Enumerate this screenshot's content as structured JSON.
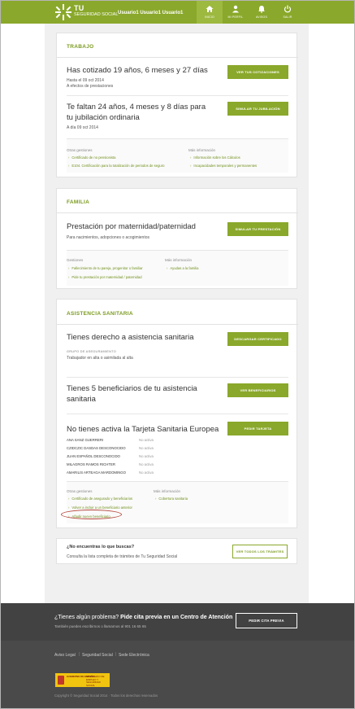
{
  "header": {
    "brand_tu": "TU",
    "brand_ss": "SEGURIDAD SOCIAL",
    "username": "Usuario1 Usuario1 Usuario1",
    "nav": [
      {
        "label": "INICIO",
        "icon": "home-icon"
      },
      {
        "label": "MI PERFIL",
        "icon": "user-icon"
      },
      {
        "label": "AVISOS",
        "icon": "bell-icon"
      },
      {
        "label": "SALIR",
        "icon": "power-icon"
      }
    ],
    "colors": {
      "accent": "#8aa82b"
    }
  },
  "trabajo": {
    "title": "TRABAJO",
    "cotizado": "Has cotizado 19 años, 6 meses y 27 días",
    "hasta": "Hasta el 09 oct 2014",
    "efectos": "A efectos de prestaciones",
    "btn_cotizaciones": "VER TUS COTIZACIONES",
    "faltan": "Te faltan 24 años, 4 meses y 8 días para tu jubilación ordinaria",
    "adia": "A día 09 oct 2014",
    "btn_jubilacion": "SIMULAR TU JUBILACIÓN",
    "gestiones_label": "Otras gestiones",
    "gestiones": [
      "Certificado de no pensionista",
      "E104. Certificación para la totalización de periodos de seguro"
    ],
    "info_label": "Más información",
    "info": [
      "Información sobre los Cálculos",
      "Incapacidades temporales y permanentes"
    ]
  },
  "familia": {
    "title": "FAMILIA",
    "prestacion": "Prestación por maternidad/paternidad",
    "desc": "Para nacimientos, adopciones o acogimientos",
    "btn": "SIMULAR TU PRESTACIÓN",
    "gestiones_label": "Gestiones",
    "gestiones": [
      "Fallecimiento de tu pareja, progenitor o familiar",
      "Pide tu prestación por maternidad / paternidad"
    ],
    "info_label": "Más información",
    "info": [
      "Ayudas a la familia"
    ]
  },
  "asistencia": {
    "title": "ASISTENCIA SANITARIA",
    "derecho": "Tienes derecho a asistencia sanitaria",
    "grupo_label": "GRUPO DE ASEGURAMIENTO",
    "grupo_value": "Trabajador en alta o asimilada al alta",
    "btn_certificado": "DESCARGAR CERTIFICADO",
    "beneficiarios": "Tienes 5 beneficiarios de tu asistencia sanitaria",
    "btn_beneficiarios": "VER BENEFICIARIOS",
    "tarjeta": "No tienes activa la Tarjeta Sanitaria Europea",
    "btn_tarjeta": "PEDIR TARJETA",
    "personas": [
      {
        "name": "ANA SANZ GUERRERI",
        "status": "No activa"
      },
      {
        "name": "CZIDCZIC DASDAS DESCONOCIDO",
        "status": "No activa"
      },
      {
        "name": "JUAN ESPAÑOL DESCONOCIDO",
        "status": "No activa"
      },
      {
        "name": "MILAGROS RAMOS RICHTER",
        "status": "No activa"
      },
      {
        "name": "AMARILIS ARTEAGA MARDOMINGO",
        "status": "No activa"
      }
    ],
    "gestiones_label": "Otras gestiones",
    "gestiones": [
      "Certificado de asegurado y beneficiarios",
      "Volver a incluir a un beneficiario anterior",
      "Añadir nuevo beneficiario"
    ],
    "info_label": "Más información",
    "info": [
      "Cobertura sanitaria"
    ]
  },
  "buscas": {
    "title": "¿No encuentras lo que buscas?",
    "desc": "Consulta la lista completa de trámites de Tu Seguridad Social",
    "btn": "VER TODOS LOS TRÁMITES"
  },
  "footer": {
    "problema": "¿Tienes algún problema?",
    "pide": "Pide cita previa en un Centro de Atención",
    "sub": "También puedes escribirnos o llamarnos al 901 16 65 65",
    "btn": "PEDIR CITA PREVIA",
    "links": [
      "Aviso Legal",
      "Seguridad Social",
      "Sede Electrónica"
    ],
    "gov1": "GOBIERNO DE ESPAÑA",
    "gov2": "MINISTERIO DE EMPLEO Y SEGURIDAD SOCIAL",
    "copyright": "Copyright © Seguridad Social 2014 · Todos los derechos reservados"
  }
}
